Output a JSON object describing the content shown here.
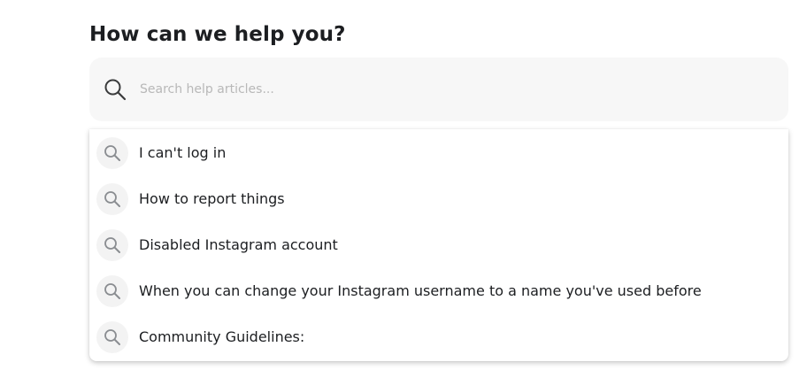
{
  "help": {
    "title": "How can we help you?",
    "search": {
      "placeholder": "Search help articles...",
      "value": "",
      "icon": "search-icon"
    },
    "suggestions": [
      {
        "label": "I can't log in",
        "icon": "search-icon"
      },
      {
        "label": "How to report things",
        "icon": "search-icon"
      },
      {
        "label": "Disabled Instagram account",
        "icon": "search-icon"
      },
      {
        "label": "When you can change your Instagram username to a name you've used before",
        "icon": "search-icon"
      },
      {
        "label": "Community Guidelines:",
        "icon": "search-icon"
      }
    ]
  },
  "colors": {
    "text": "#1c1e21",
    "placeholder": "#b8b8b8",
    "search_bg": "#f7f7f7",
    "icon_bg": "#f3f3f3",
    "icon": "#8a8d91"
  }
}
